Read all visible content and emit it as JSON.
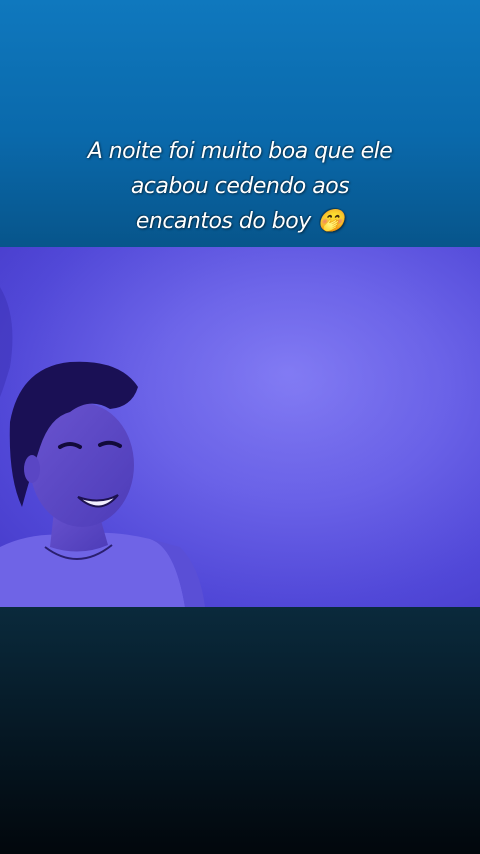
{
  "caption": {
    "line1": "A noite foi muito boa que ele",
    "line2": "acabou cedendo aos",
    "line3": "encantos do boy",
    "emoji": "🤭"
  },
  "video": {
    "icon": "smiling-person-video-still"
  }
}
